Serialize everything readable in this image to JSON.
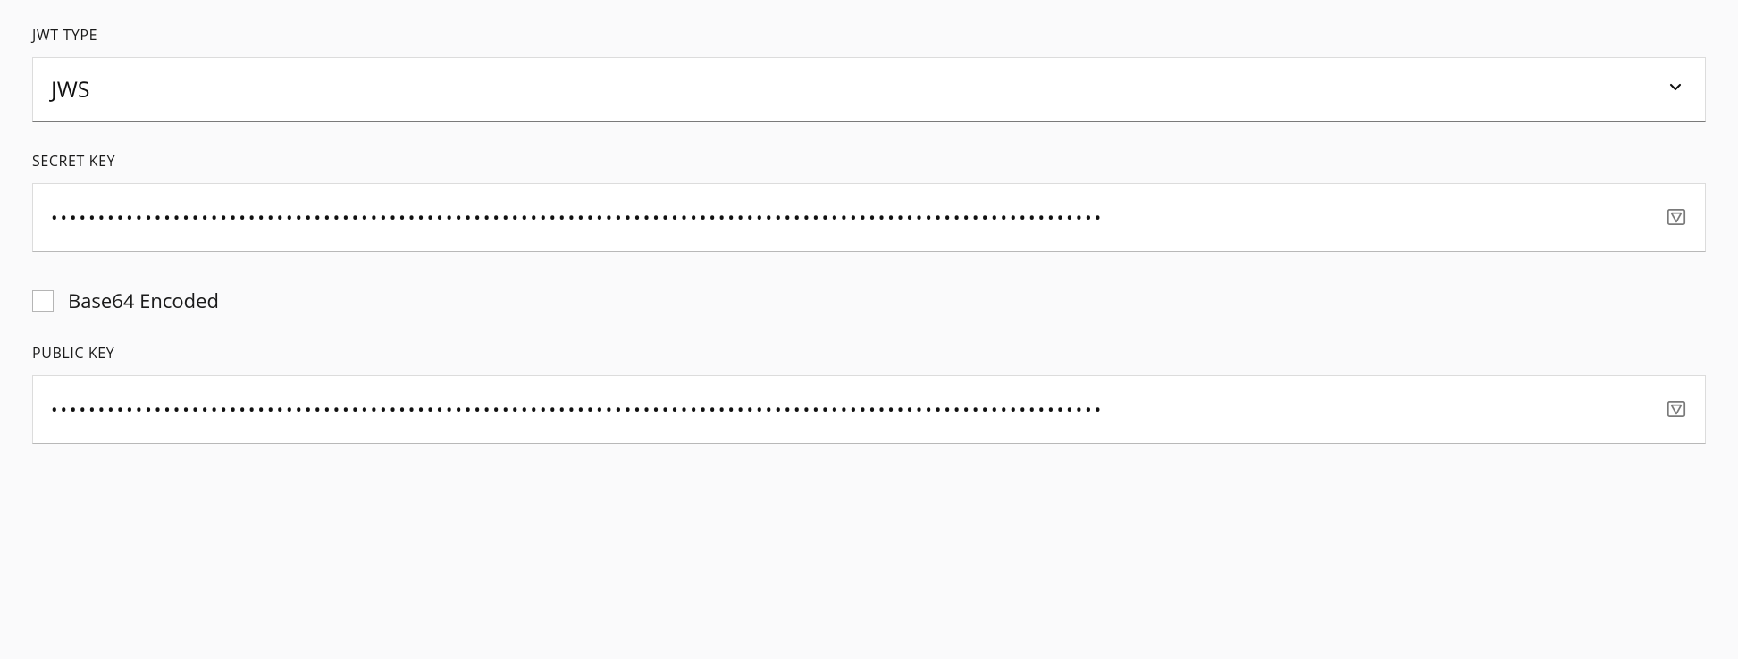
{
  "jwtType": {
    "label": "JWT TYPE",
    "value": "JWS"
  },
  "secretKey": {
    "label": "SECRET KEY",
    "value": "••••••••••••••••••••••••••••••••••••••••••••••••••••••••••••••••••••••••••••••••••••••••••••••••••••••••••••••••"
  },
  "base64": {
    "label": "Base64 Encoded",
    "checked": false
  },
  "publicKey": {
    "label": "PUBLIC KEY",
    "value": "••••••••••••••••••••••••••••••••••••••••••••••••••••••••••••••••••••••••••••••••••••••••••••••••••••••••••••••••"
  }
}
